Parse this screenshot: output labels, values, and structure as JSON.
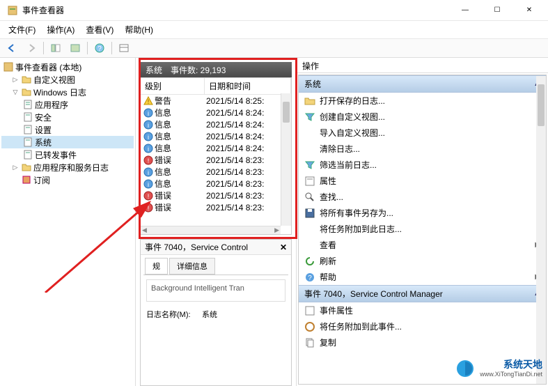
{
  "window": {
    "title": "事件查看器",
    "min": "—",
    "max": "☐",
    "close": "✕"
  },
  "menu": {
    "file": "文件(F)",
    "action": "操作(A)",
    "view": "查看(V)",
    "help": "帮助(H)"
  },
  "tree": {
    "root": "事件查看器 (本地)",
    "custom_views": "自定义视图",
    "windows_logs": "Windows 日志",
    "app": "应用程序",
    "security": "安全",
    "setup": "设置",
    "system": "系统",
    "forwarded": "已转发事件",
    "app_svc_logs": "应用程序和服务日志",
    "subscriptions": "订阅"
  },
  "list": {
    "section_title": "系统",
    "event_count_label": "事件数: 29,193",
    "col_level": "级别",
    "col_datetime": "日期和时间",
    "rows": [
      {
        "level": "警告",
        "icon": "warning",
        "datetime": "2021/5/14 8:25:"
      },
      {
        "level": "信息",
        "icon": "info",
        "datetime": "2021/5/14 8:24:"
      },
      {
        "level": "信息",
        "icon": "info",
        "datetime": "2021/5/14 8:24:"
      },
      {
        "level": "信息",
        "icon": "info",
        "datetime": "2021/5/14 8:24:"
      },
      {
        "level": "信息",
        "icon": "info",
        "datetime": "2021/5/14 8:24:"
      },
      {
        "level": "错误",
        "icon": "error",
        "datetime": "2021/5/14 8:23:"
      },
      {
        "level": "信息",
        "icon": "info",
        "datetime": "2021/5/14 8:23:"
      },
      {
        "level": "信息",
        "icon": "info",
        "datetime": "2021/5/14 8:23:"
      },
      {
        "level": "错误",
        "icon": "error",
        "datetime": "2021/5/14 8:23:"
      },
      {
        "level": "错误",
        "icon": "error",
        "datetime": "2021/5/14 8:23:"
      }
    ]
  },
  "detail": {
    "title": "事件 7040，Service Control",
    "close": "✕",
    "tab_general": "规",
    "tab_details": "详细信息",
    "description": "Background Intelligent Tran",
    "log_name_label": "日志名称(M):",
    "log_name_value": "系统"
  },
  "actions": {
    "panel_title": "操作",
    "section_system": "系统",
    "open_saved": "打开保存的日志...",
    "create_view": "创建自定义视图...",
    "import_view": "导入自定义视图...",
    "clear_log": "清除日志...",
    "filter_current": "筛选当前日志...",
    "properties": "属性",
    "find": "查找...",
    "save_all": "将所有事件另存为...",
    "attach_task": "将任务附加到此日志...",
    "view": "查看",
    "refresh": "刷新",
    "help": "帮助",
    "section_event": "事件 7040，Service Control Manager",
    "event_props": "事件属性",
    "attach_task_event": "将任务附加到此事件...",
    "copy": "复制",
    "collapse": "▲",
    "expand_arrow": "▶"
  },
  "watermark": {
    "main": "系统天地",
    "sub": "www.XiTongTianDi.net"
  }
}
